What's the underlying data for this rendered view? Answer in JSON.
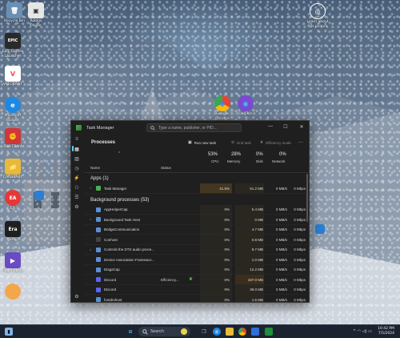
{
  "desktop": {
    "icons": [
      {
        "label": "Recycle Bin",
        "color": "#6b8fb3",
        "glyph": "🗑"
      },
      {
        "label": "Roblox Player",
        "color": "#e6e6e6",
        "glyph": "▣"
      },
      {
        "label": "Epic Games Launcher",
        "color": "#2a2a2a",
        "glyph": "EPIC"
      },
      {
        "label": "VALORANT",
        "color": "#ff4655",
        "glyph": "V"
      },
      {
        "label": "Microsoft Edge",
        "color": "#1e88e5",
        "glyph": "e"
      },
      {
        "label": "Riot Client",
        "color": "#d13639",
        "glyph": "✊"
      },
      {
        "label": "CARBBABY",
        "color": "#e8b93b",
        "glyph": "📁"
      },
      {
        "label": "EA",
        "color": "#e53935",
        "glyph": "EA"
      },
      {
        "label": "Era",
        "color": "#202020",
        "glyph": "Era"
      },
      {
        "label": "Play Roblox",
        "color": "#6a4bc4",
        "glyph": "▶"
      },
      {
        "label": "Learn about this picture",
        "color": "#3b4a5c",
        "glyph": "◎"
      },
      {
        "label": "Google Chrome",
        "color": "#ffffff",
        "glyph": "◉"
      },
      {
        "label": "Dolphin",
        "color": "#7a4bd0",
        "glyph": "◉"
      }
    ]
  },
  "taskmanager": {
    "title": "Task Manager",
    "search_placeholder": "Type a name, publisher, or PID...",
    "window_controls": {
      "minimize": "—",
      "maximize": "☐",
      "close": "✕"
    },
    "page_heading": "Processes",
    "toolbar": {
      "run_new_task": "Run new task",
      "end_task": "End task",
      "efficiency_mode": "Efficiency mode",
      "more": "···"
    },
    "columns": {
      "name": "Name",
      "status": "Status",
      "cpu_pct": "53%",
      "cpu": "CPU",
      "memory_pct": "28%",
      "memory": "Memory",
      "disk_pct": "0%",
      "disk": "Disk",
      "network_pct": "0%",
      "network": "Network"
    },
    "groups": {
      "apps": "Apps (1)",
      "background": "Background processes (53)"
    },
    "apps": [
      {
        "name": "Task Manager",
        "status": "",
        "cpu": "41.5%",
        "memory": "51.2 MB",
        "disk": "0 MB/s",
        "network": "0 Mbps",
        "color": "#4caf50",
        "expandable": true
      }
    ],
    "background": [
      {
        "name": "AppHelperCap",
        "status": "",
        "cpu": "0%",
        "memory": "5.4 MB",
        "disk": "0 MB/s",
        "network": "0 Mbps",
        "color": "#5b8fd6",
        "expandable": false
      },
      {
        "name": "Background Task Host",
        "status": "",
        "cpu": "0%",
        "memory": "0 MB",
        "disk": "0 MB/s",
        "network": "0 Mbps",
        "color": "#5b8fd6",
        "expandable": true
      },
      {
        "name": "BridgeCommunication",
        "status": "",
        "cpu": "0%",
        "memory": "4.7 MB",
        "disk": "0 MB/s",
        "network": "0 Mbps",
        "color": "#5b8fd6",
        "expandable": false
      },
      {
        "name": "Conhost",
        "status": "",
        "cpu": "0%",
        "memory": "0.8 MB",
        "disk": "0 MB/s",
        "network": "0 Mbps",
        "color": "#444444",
        "expandable": false
      },
      {
        "name": "Controls the DTS audio proce...",
        "status": "",
        "cpu": "0%",
        "memory": "9.7 MB",
        "disk": "0 MB/s",
        "network": "0 Mbps",
        "color": "#5b8fd6",
        "expandable": true
      },
      {
        "name": "Device Association Framewor...",
        "status": "",
        "cpu": "0%",
        "memory": "1.0 MB",
        "disk": "0 MB/s",
        "network": "0 Mbps",
        "color": "#5b8fd6",
        "expandable": false
      },
      {
        "name": "DiagsCap",
        "status": "",
        "cpu": "0%",
        "memory": "12.2 MB",
        "disk": "0 MB/s",
        "network": "0 Mbps",
        "color": "#5b8fd6",
        "expandable": false
      },
      {
        "name": "Discord",
        "status": "Efficiency...",
        "cpu": "0%",
        "memory": "187.0 MB",
        "disk": "0 MB/s",
        "network": "0 Mbps",
        "color": "#5865f2",
        "expandable": false,
        "efficiency": true
      },
      {
        "name": "Discord",
        "status": "",
        "cpu": "0%",
        "memory": "39.0 MB",
        "disk": "0 MB/s",
        "network": "0 Mbps",
        "color": "#5865f2",
        "expandable": false
      },
      {
        "name": "fontdrvhost",
        "status": "",
        "cpu": "0%",
        "memory": "1.6 MB",
        "disk": "0 MB/s",
        "network": "0 Mbps",
        "color": "#5b8fd6",
        "expandable": false
      },
      {
        "name": "fontdrvhost",
        "status": "",
        "cpu": "0%",
        "memory": "1.2 MB",
        "disk": "0 MB/s",
        "network": "0 Mbps",
        "color": "#5b8fd6",
        "expandable": false
      },
      {
        "name": "Game Bar",
        "status": "",
        "cpu": "0%",
        "memory": "22.9 MB",
        "disk": "0 MB/s",
        "network": "0 Mbps",
        "color": "#3a7bd5",
        "expandable": true
      }
    ]
  },
  "taskbar": {
    "search_label": "Search",
    "time": "10:42 PM",
    "date": "7/5/2024"
  }
}
